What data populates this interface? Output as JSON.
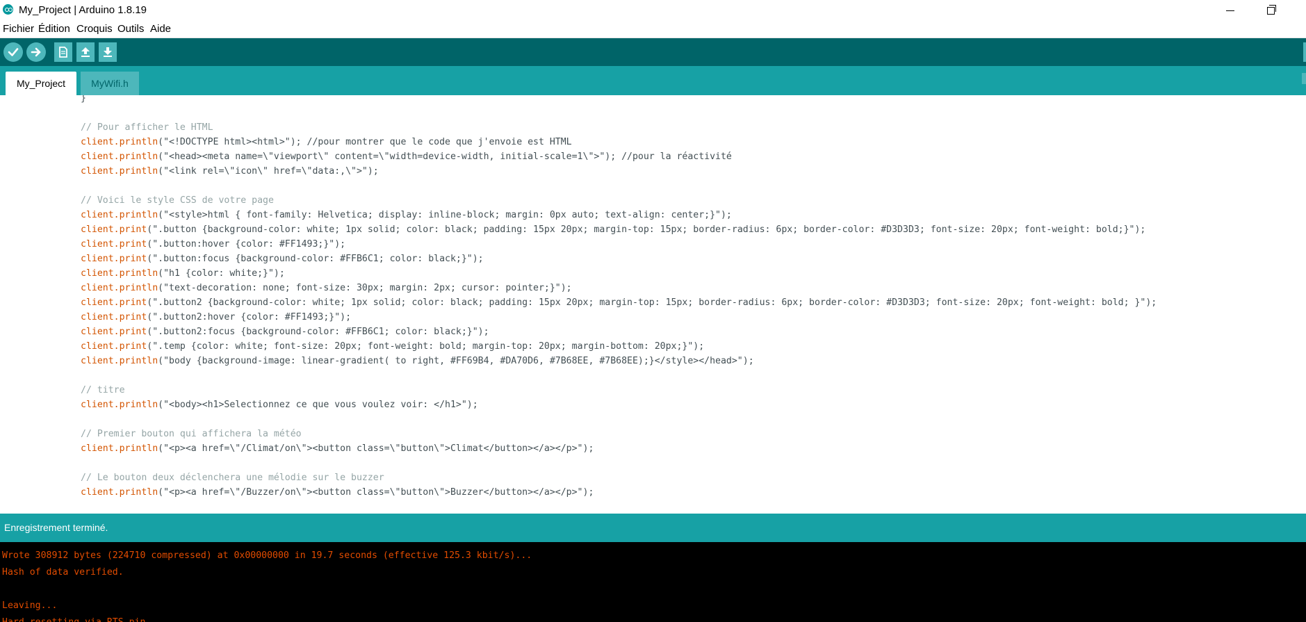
{
  "window": {
    "title": "My_Project | Arduino 1.8.19",
    "app_icon": "arduino-logo-icon",
    "controls": [
      "minimize-icon",
      "restore-icon"
    ]
  },
  "menu": {
    "items": [
      "Fichier",
      "Édition",
      "Croquis",
      "Outils",
      "Aide"
    ]
  },
  "toolbar": {
    "buttons": [
      {
        "name": "verify",
        "icon": "checkmark-icon"
      },
      {
        "name": "upload",
        "icon": "arrow-right-icon"
      },
      {
        "name": "new",
        "icon": "new-file-icon"
      },
      {
        "name": "open",
        "icon": "arrow-up-icon"
      },
      {
        "name": "save",
        "icon": "arrow-down-icon"
      }
    ]
  },
  "tabs": [
    {
      "label": "My_Project",
      "active": true
    },
    {
      "label": "MyWifi.h",
      "active": false
    }
  ],
  "editor": {
    "lines": [
      {
        "type": "code",
        "prefix": "",
        "text": "}"
      },
      {
        "type": "blank"
      },
      {
        "type": "comment",
        "text": "// Pour afficher le HTML"
      },
      {
        "type": "code",
        "prefix": "client.println",
        "text": "(\"<!DOCTYPE html><html>\"); //pour montrer que le code que j'envoie est HTML"
      },
      {
        "type": "code",
        "prefix": "client.println",
        "text": "(\"<head><meta name=\\\"viewport\\\" content=\\\"width=device-width, initial-scale=1\\\">\"); //pour la réactivité"
      },
      {
        "type": "code",
        "prefix": "client.println",
        "text": "(\"<link rel=\\\"icon\\\" href=\\\"data:,\\\">\");"
      },
      {
        "type": "blank"
      },
      {
        "type": "comment",
        "text": "// Voici le style CSS de votre page"
      },
      {
        "type": "code",
        "prefix": "client.println",
        "text": "(\"<style>html { font-family: Helvetica; display: inline-block; margin: 0px auto; text-align: center;}\");"
      },
      {
        "type": "code",
        "prefix": "client.print",
        "text": "(\".button {background-color: white; 1px solid; color: black; padding: 15px 20px; margin-top: 15px; border-radius: 6px; border-color: #D3D3D3; font-size: 20px; font-weight: bold;}\");"
      },
      {
        "type": "code",
        "prefix": "client.print",
        "text": "(\".button:hover {color: #FF1493;}\");"
      },
      {
        "type": "code",
        "prefix": "client.print",
        "text": "(\".button:focus {background-color: #FFB6C1; color: black;}\");"
      },
      {
        "type": "code",
        "prefix": "client.println",
        "text": "(\"h1 {color: white;}\");"
      },
      {
        "type": "code",
        "prefix": "client.println",
        "text": "(\"text-decoration: none; font-size: 30px; margin: 2px; cursor: pointer;}\");"
      },
      {
        "type": "code",
        "prefix": "client.print",
        "text": "(\".button2 {background-color: white; 1px solid; color: black; padding: 15px 20px; margin-top: 15px; border-radius: 6px; border-color: #D3D3D3; font-size: 20px; font-weight: bold; }\");"
      },
      {
        "type": "code",
        "prefix": "client.print",
        "text": "(\".button2:hover {color: #FF1493;}\");"
      },
      {
        "type": "code",
        "prefix": "client.print",
        "text": "(\".button2:focus {background-color: #FFB6C1; color: black;}\");"
      },
      {
        "type": "code",
        "prefix": "client.print",
        "text": "(\".temp {color: white; font-size: 20px; font-weight: bold; margin-top: 20px; margin-bottom: 20px;}\");"
      },
      {
        "type": "code",
        "prefix": "client.println",
        "text": "(\"body {background-image: linear-gradient( to right, #FF69B4, #DA70D6, #7B68EE, #7B68EE);}</style></head>\");"
      },
      {
        "type": "blank"
      },
      {
        "type": "comment",
        "text": "// titre"
      },
      {
        "type": "code",
        "prefix": "client.println",
        "text": "(\"<body><h1>Selectionnez ce que vous voulez voir: </h1>\");"
      },
      {
        "type": "blank"
      },
      {
        "type": "comment",
        "text": "// Premier bouton qui affichera la météo"
      },
      {
        "type": "code",
        "prefix": "client.println",
        "text": "(\"<p><a href=\\\"/Climat/on\\\"><button class=\\\"button\\\">Climat</button></a></p>\");"
      },
      {
        "type": "blank"
      },
      {
        "type": "comment",
        "text": "// Le bouton deux déclenchera une mélodie sur le buzzer"
      },
      {
        "type": "code",
        "prefix": "client.println",
        "text": "(\"<p><a href=\\\"/Buzzer/on\\\"><button class=\\\"button\\\">Buzzer</button></a></p>\");"
      }
    ]
  },
  "status": {
    "message": "Enregistrement terminé."
  },
  "console": {
    "lines": [
      "Wrote 308912 bytes (224710 compressed) at 0x00000000 in 19.7 seconds (effective 125.3 kbit/s)...",
      "Hash of data verified.",
      "",
      "Leaving...",
      "Hard resetting via RTS pin..."
    ]
  },
  "colors": {
    "toolbar_bg": "#006468",
    "tabs_bg": "#17a1a5",
    "button_bg": "#4db7bb",
    "keyword": "#d35400",
    "comment": "#95a5a6",
    "console_text": "#e34c00"
  }
}
